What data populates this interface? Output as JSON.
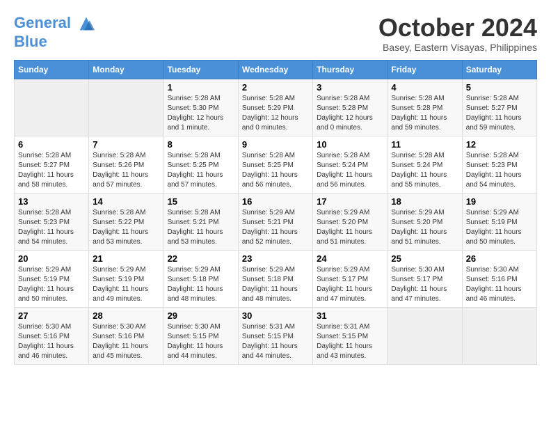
{
  "logo": {
    "line1": "General",
    "line2": "Blue"
  },
  "title": "October 2024",
  "subtitle": "Basey, Eastern Visayas, Philippines",
  "headers": [
    "Sunday",
    "Monday",
    "Tuesday",
    "Wednesday",
    "Thursday",
    "Friday",
    "Saturday"
  ],
  "weeks": [
    [
      {
        "day": "",
        "sunrise": "",
        "sunset": "",
        "daylight": ""
      },
      {
        "day": "",
        "sunrise": "",
        "sunset": "",
        "daylight": ""
      },
      {
        "day": "1",
        "sunrise": "Sunrise: 5:28 AM",
        "sunset": "Sunset: 5:30 PM",
        "daylight": "Daylight: 12 hours and 1 minute."
      },
      {
        "day": "2",
        "sunrise": "Sunrise: 5:28 AM",
        "sunset": "Sunset: 5:29 PM",
        "daylight": "Daylight: 12 hours and 0 minutes."
      },
      {
        "day": "3",
        "sunrise": "Sunrise: 5:28 AM",
        "sunset": "Sunset: 5:28 PM",
        "daylight": "Daylight: 12 hours and 0 minutes."
      },
      {
        "day": "4",
        "sunrise": "Sunrise: 5:28 AM",
        "sunset": "Sunset: 5:28 PM",
        "daylight": "Daylight: 11 hours and 59 minutes."
      },
      {
        "day": "5",
        "sunrise": "Sunrise: 5:28 AM",
        "sunset": "Sunset: 5:27 PM",
        "daylight": "Daylight: 11 hours and 59 minutes."
      }
    ],
    [
      {
        "day": "6",
        "sunrise": "Sunrise: 5:28 AM",
        "sunset": "Sunset: 5:27 PM",
        "daylight": "Daylight: 11 hours and 58 minutes."
      },
      {
        "day": "7",
        "sunrise": "Sunrise: 5:28 AM",
        "sunset": "Sunset: 5:26 PM",
        "daylight": "Daylight: 11 hours and 57 minutes."
      },
      {
        "day": "8",
        "sunrise": "Sunrise: 5:28 AM",
        "sunset": "Sunset: 5:25 PM",
        "daylight": "Daylight: 11 hours and 57 minutes."
      },
      {
        "day": "9",
        "sunrise": "Sunrise: 5:28 AM",
        "sunset": "Sunset: 5:25 PM",
        "daylight": "Daylight: 11 hours and 56 minutes."
      },
      {
        "day": "10",
        "sunrise": "Sunrise: 5:28 AM",
        "sunset": "Sunset: 5:24 PM",
        "daylight": "Daylight: 11 hours and 56 minutes."
      },
      {
        "day": "11",
        "sunrise": "Sunrise: 5:28 AM",
        "sunset": "Sunset: 5:24 PM",
        "daylight": "Daylight: 11 hours and 55 minutes."
      },
      {
        "day": "12",
        "sunrise": "Sunrise: 5:28 AM",
        "sunset": "Sunset: 5:23 PM",
        "daylight": "Daylight: 11 hours and 54 minutes."
      }
    ],
    [
      {
        "day": "13",
        "sunrise": "Sunrise: 5:28 AM",
        "sunset": "Sunset: 5:23 PM",
        "daylight": "Daylight: 11 hours and 54 minutes."
      },
      {
        "day": "14",
        "sunrise": "Sunrise: 5:28 AM",
        "sunset": "Sunset: 5:22 PM",
        "daylight": "Daylight: 11 hours and 53 minutes."
      },
      {
        "day": "15",
        "sunrise": "Sunrise: 5:28 AM",
        "sunset": "Sunset: 5:21 PM",
        "daylight": "Daylight: 11 hours and 53 minutes."
      },
      {
        "day": "16",
        "sunrise": "Sunrise: 5:29 AM",
        "sunset": "Sunset: 5:21 PM",
        "daylight": "Daylight: 11 hours and 52 minutes."
      },
      {
        "day": "17",
        "sunrise": "Sunrise: 5:29 AM",
        "sunset": "Sunset: 5:20 PM",
        "daylight": "Daylight: 11 hours and 51 minutes."
      },
      {
        "day": "18",
        "sunrise": "Sunrise: 5:29 AM",
        "sunset": "Sunset: 5:20 PM",
        "daylight": "Daylight: 11 hours and 51 minutes."
      },
      {
        "day": "19",
        "sunrise": "Sunrise: 5:29 AM",
        "sunset": "Sunset: 5:19 PM",
        "daylight": "Daylight: 11 hours and 50 minutes."
      }
    ],
    [
      {
        "day": "20",
        "sunrise": "Sunrise: 5:29 AM",
        "sunset": "Sunset: 5:19 PM",
        "daylight": "Daylight: 11 hours and 50 minutes."
      },
      {
        "day": "21",
        "sunrise": "Sunrise: 5:29 AM",
        "sunset": "Sunset: 5:19 PM",
        "daylight": "Daylight: 11 hours and 49 minutes."
      },
      {
        "day": "22",
        "sunrise": "Sunrise: 5:29 AM",
        "sunset": "Sunset: 5:18 PM",
        "daylight": "Daylight: 11 hours and 48 minutes."
      },
      {
        "day": "23",
        "sunrise": "Sunrise: 5:29 AM",
        "sunset": "Sunset: 5:18 PM",
        "daylight": "Daylight: 11 hours and 48 minutes."
      },
      {
        "day": "24",
        "sunrise": "Sunrise: 5:29 AM",
        "sunset": "Sunset: 5:17 PM",
        "daylight": "Daylight: 11 hours and 47 minutes."
      },
      {
        "day": "25",
        "sunrise": "Sunrise: 5:30 AM",
        "sunset": "Sunset: 5:17 PM",
        "daylight": "Daylight: 11 hours and 47 minutes."
      },
      {
        "day": "26",
        "sunrise": "Sunrise: 5:30 AM",
        "sunset": "Sunset: 5:16 PM",
        "daylight": "Daylight: 11 hours and 46 minutes."
      }
    ],
    [
      {
        "day": "27",
        "sunrise": "Sunrise: 5:30 AM",
        "sunset": "Sunset: 5:16 PM",
        "daylight": "Daylight: 11 hours and 46 minutes."
      },
      {
        "day": "28",
        "sunrise": "Sunrise: 5:30 AM",
        "sunset": "Sunset: 5:16 PM",
        "daylight": "Daylight: 11 hours and 45 minutes."
      },
      {
        "day": "29",
        "sunrise": "Sunrise: 5:30 AM",
        "sunset": "Sunset: 5:15 PM",
        "daylight": "Daylight: 11 hours and 44 minutes."
      },
      {
        "day": "30",
        "sunrise": "Sunrise: 5:31 AM",
        "sunset": "Sunset: 5:15 PM",
        "daylight": "Daylight: 11 hours and 44 minutes."
      },
      {
        "day": "31",
        "sunrise": "Sunrise: 5:31 AM",
        "sunset": "Sunset: 5:15 PM",
        "daylight": "Daylight: 11 hours and 43 minutes."
      },
      {
        "day": "",
        "sunrise": "",
        "sunset": "",
        "daylight": ""
      },
      {
        "day": "",
        "sunrise": "",
        "sunset": "",
        "daylight": ""
      }
    ]
  ]
}
